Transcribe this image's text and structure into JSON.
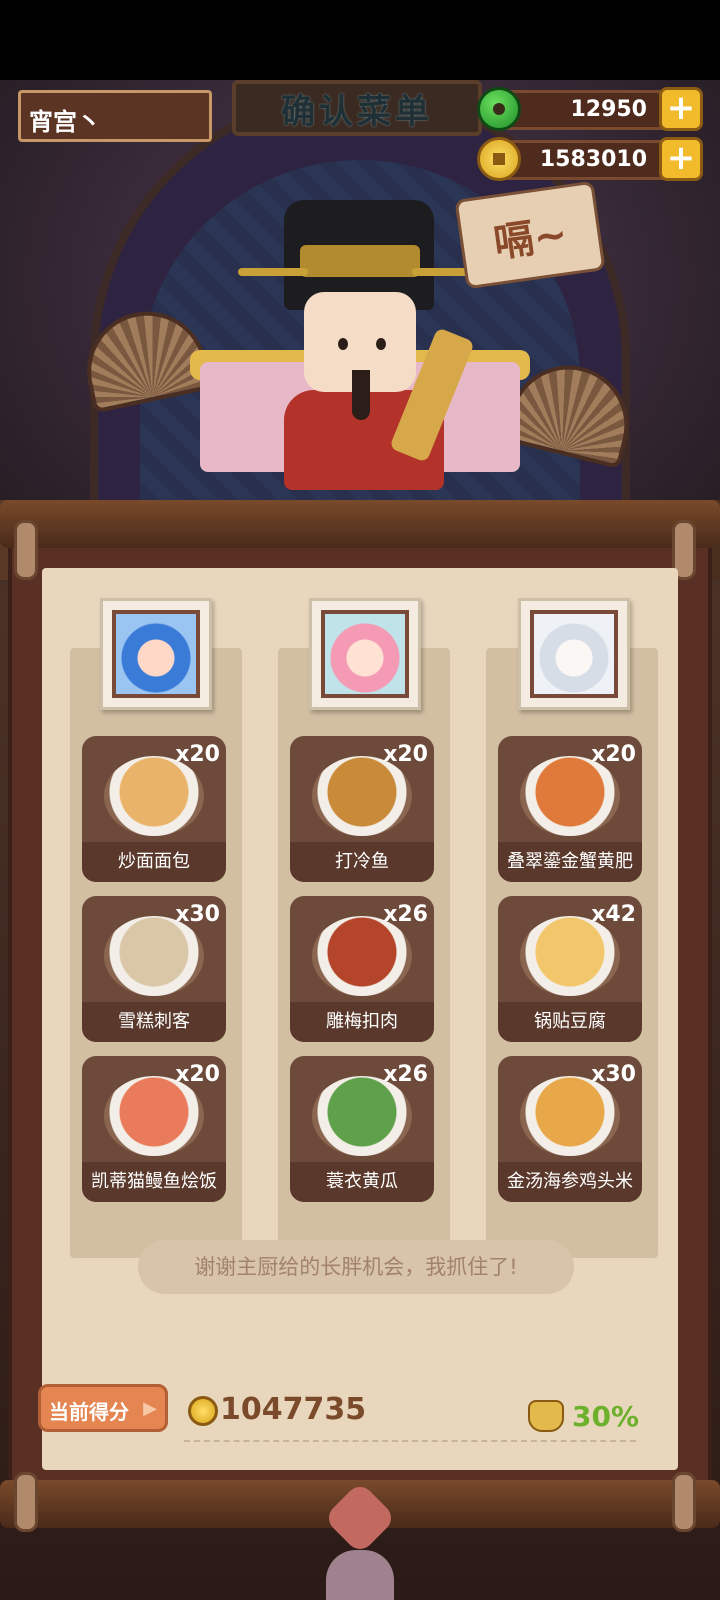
{
  "header": {
    "plaque_title": "确认菜单",
    "player_name": "宵宫丶",
    "speech": "嗝~"
  },
  "currency": {
    "jade": {
      "icon": "jade-icon",
      "value": "12950",
      "add_icon": "plus-icon",
      "add_label": "+"
    },
    "coins": {
      "icon": "coin-icon",
      "value": "1583010",
      "add_icon": "plus-icon",
      "add_label": "+"
    }
  },
  "menu": {
    "columns": [
      {
        "portrait": "chef-portrait-blue",
        "dishes": [
          {
            "name": "炒面面包",
            "qty": "x20",
            "color": "#e9b36a"
          },
          {
            "name": "雪糕刺客",
            "qty": "x30",
            "color": "#d9c7a7"
          },
          {
            "name": "凯蒂猫鳗鱼烩饭",
            "qty": "x20",
            "color": "#e97a5a"
          }
        ]
      },
      {
        "portrait": "chef-portrait-pink",
        "dishes": [
          {
            "name": "打冷鱼",
            "qty": "x20",
            "color": "#c98a3a"
          },
          {
            "name": "雕梅扣肉",
            "qty": "x26",
            "color": "#b5452a"
          },
          {
            "name": "蓑衣黄瓜",
            "qty": "x26",
            "color": "#5fa04a"
          }
        ]
      },
      {
        "portrait": "chef-portrait-white",
        "dishes": [
          {
            "name": "叠翠鎏金蟹黄肥",
            "qty": "x20",
            "color": "#e07a3a"
          },
          {
            "name": "锅贴豆腐",
            "qty": "x42",
            "color": "#f2c66a"
          },
          {
            "name": "金汤海参鸡头米",
            "qty": "x30",
            "color": "#e8a84a"
          }
        ]
      }
    ]
  },
  "quote": "谢谢主厨给的长胖机会，我抓住了!",
  "score": {
    "button_label": "当前得分",
    "arrow": "▶",
    "value": "1047735",
    "bonus": "30%"
  }
}
